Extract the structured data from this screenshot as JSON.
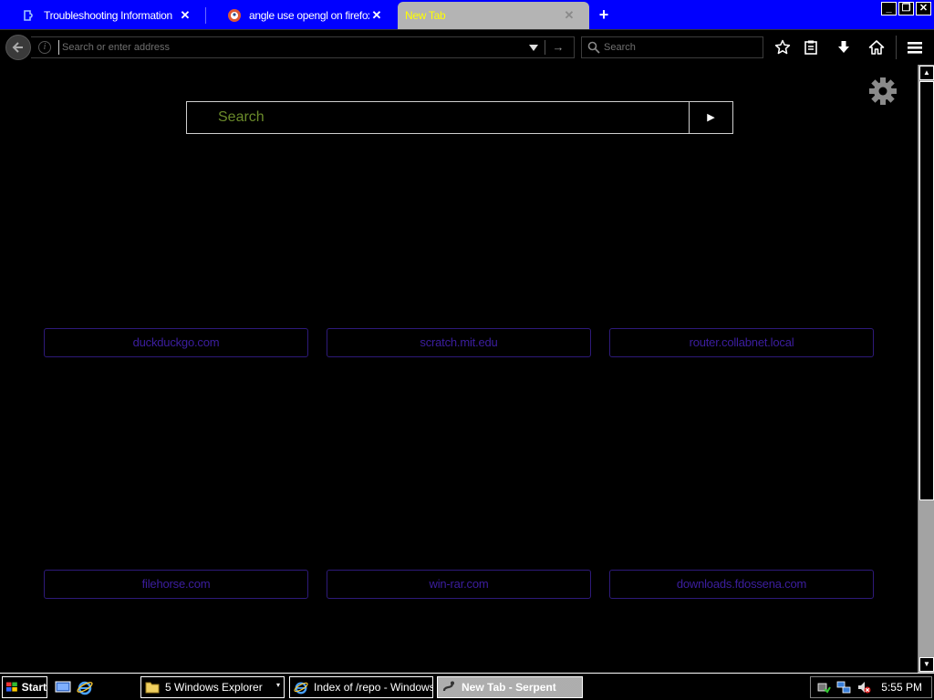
{
  "tabs": [
    {
      "title": "Troubleshooting Information",
      "close": "✕"
    },
    {
      "title": "angle use opengl on firefox at D",
      "close": "✕"
    },
    {
      "title": "New Tab",
      "close": "✕",
      "active": true
    }
  ],
  "tabstrip": {
    "new_tab": "+"
  },
  "window_controls": {
    "minimize": "_",
    "maximize": "❐",
    "close": "✕"
  },
  "navbar": {
    "url_placeholder": "Search or enter address",
    "info": "i",
    "go": "→",
    "search_placeholder": "Search"
  },
  "page": {
    "search_placeholder": "Search",
    "search_button": "▶",
    "tiles_row1": [
      "duckduckgo.com",
      "scratch.mit.edu",
      "router.collabnet.local"
    ],
    "tiles_row2": [
      "filehorse.com",
      "win-rar.com",
      "downloads.fdossena.com"
    ]
  },
  "scrollbar": {
    "up": "▲",
    "down": "▼"
  },
  "taskbar": {
    "start": "Start",
    "tasks": [
      "5 Windows Explorer",
      "Index of /repo - Windows...",
      "New Tab - Serpent"
    ],
    "explorer_dropdown": "▾",
    "clock": "5:55 PM"
  },
  "colors": {
    "tabstrip": "#0000ff",
    "active_tab_bg": "#b4b4b4",
    "active_tab_text": "#ffff00",
    "tile_border": "#2e1a7a",
    "tile_text": "#3c1ea0",
    "page_search_text": "#6a8a2a"
  }
}
